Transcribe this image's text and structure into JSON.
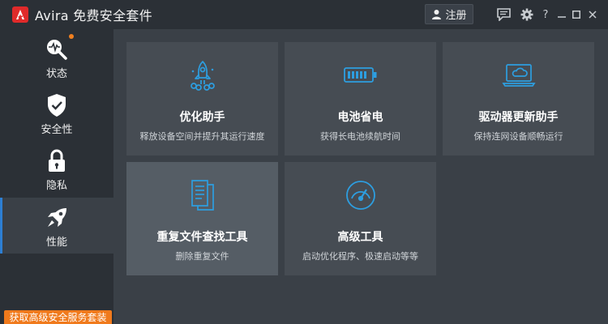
{
  "app": {
    "title": "Avira 免费安全套件"
  },
  "header": {
    "register_label": "注册"
  },
  "window_controls": {
    "help": "?"
  },
  "sidebar": {
    "items": [
      {
        "label": "状态",
        "icon": "heart-pulse-search-icon",
        "badge": true
      },
      {
        "label": "安全性",
        "icon": "shield-check-icon"
      },
      {
        "label": "隐私",
        "icon": "lock-icon"
      },
      {
        "label": "性能",
        "icon": "rocket-icon",
        "active": true
      }
    ],
    "promo": "获取高级安全服务套装"
  },
  "tiles": [
    {
      "title": "优化助手",
      "desc": "释放设备空间并提升其运行速度",
      "icon": "rocket-launch-icon"
    },
    {
      "title": "电池省电",
      "desc": "获得长电池续航时间",
      "icon": "battery-icon"
    },
    {
      "title": "驱动器更新助手",
      "desc": "保持连网设备顺畅运行",
      "icon": "laptop-cloud-icon"
    },
    {
      "title": "重复文件查找工具",
      "desc": "删除重复文件",
      "icon": "duplicate-files-icon"
    },
    {
      "title": "高级工具",
      "desc": "启动优化程序、极速启动等等",
      "icon": "gauge-icon"
    }
  ],
  "colors": {
    "accent": "#2d9ee0",
    "brand": "#e02a2a",
    "promo": "#f07a1c",
    "badge": "#f08020"
  }
}
